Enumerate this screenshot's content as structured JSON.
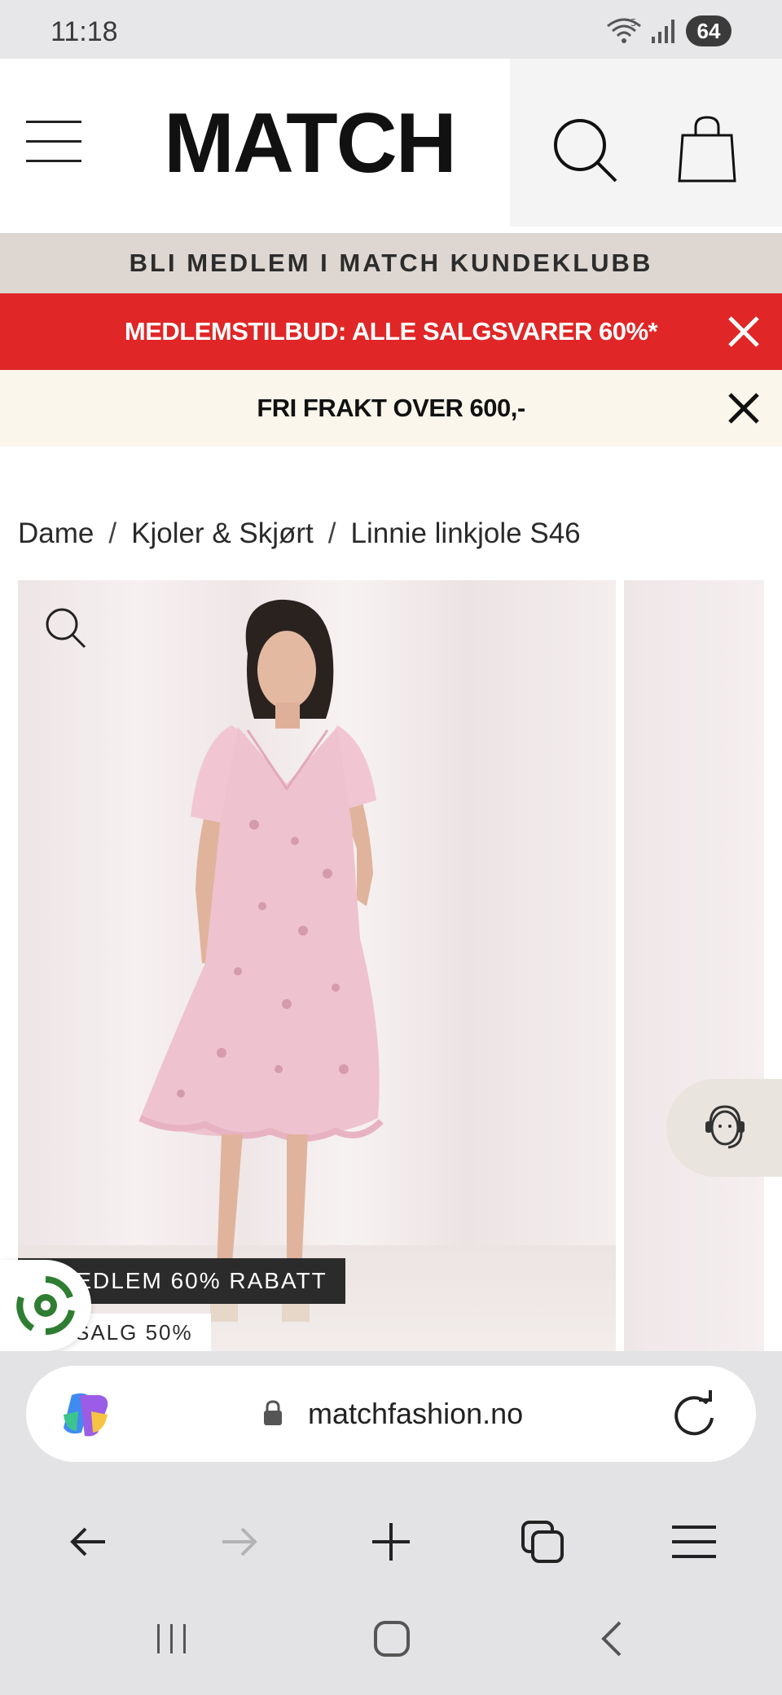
{
  "status_bar": {
    "time": "11:18",
    "battery": "64",
    "network_label": "5"
  },
  "header": {
    "logo_text": "MATCH"
  },
  "banners": {
    "member_club": "BLI MEDLEM I MATCH KUNDEKLUBB",
    "sale_offer": "MEDLEMSTILBUD: ALLE SALGSVARER 60%*",
    "free_shipping": "FRI FRAKT OVER 600,-"
  },
  "breadcrumb": {
    "items": [
      "Dame",
      "Kjoler & Skjørt",
      "Linnie linkjole S46"
    ],
    "separator": "/"
  },
  "product": {
    "badge_member": "MEDLEM 60% RABATT",
    "badge_sale": "SALG 50%"
  },
  "browser": {
    "url": "matchfashion.no"
  },
  "colors": {
    "sale_banner": "#e02626",
    "member_banner": "#ddd6d1",
    "freight_banner": "#faf6ec",
    "dress_pink": "#efc2cf"
  },
  "icons": {
    "menu": "hamburger-menu-icon",
    "search": "search-icon",
    "bag": "shopping-bag-icon",
    "close": "close-icon",
    "zoom": "zoom-icon",
    "support": "customer-support-icon",
    "recycle": "recycle-icon",
    "lock": "lock-icon",
    "reload": "reload-icon",
    "back": "arrow-left-icon",
    "forward": "arrow-right-icon",
    "new_tab": "plus-icon",
    "tabs": "tabs-icon",
    "browser_menu": "hamburger-menu-icon"
  }
}
